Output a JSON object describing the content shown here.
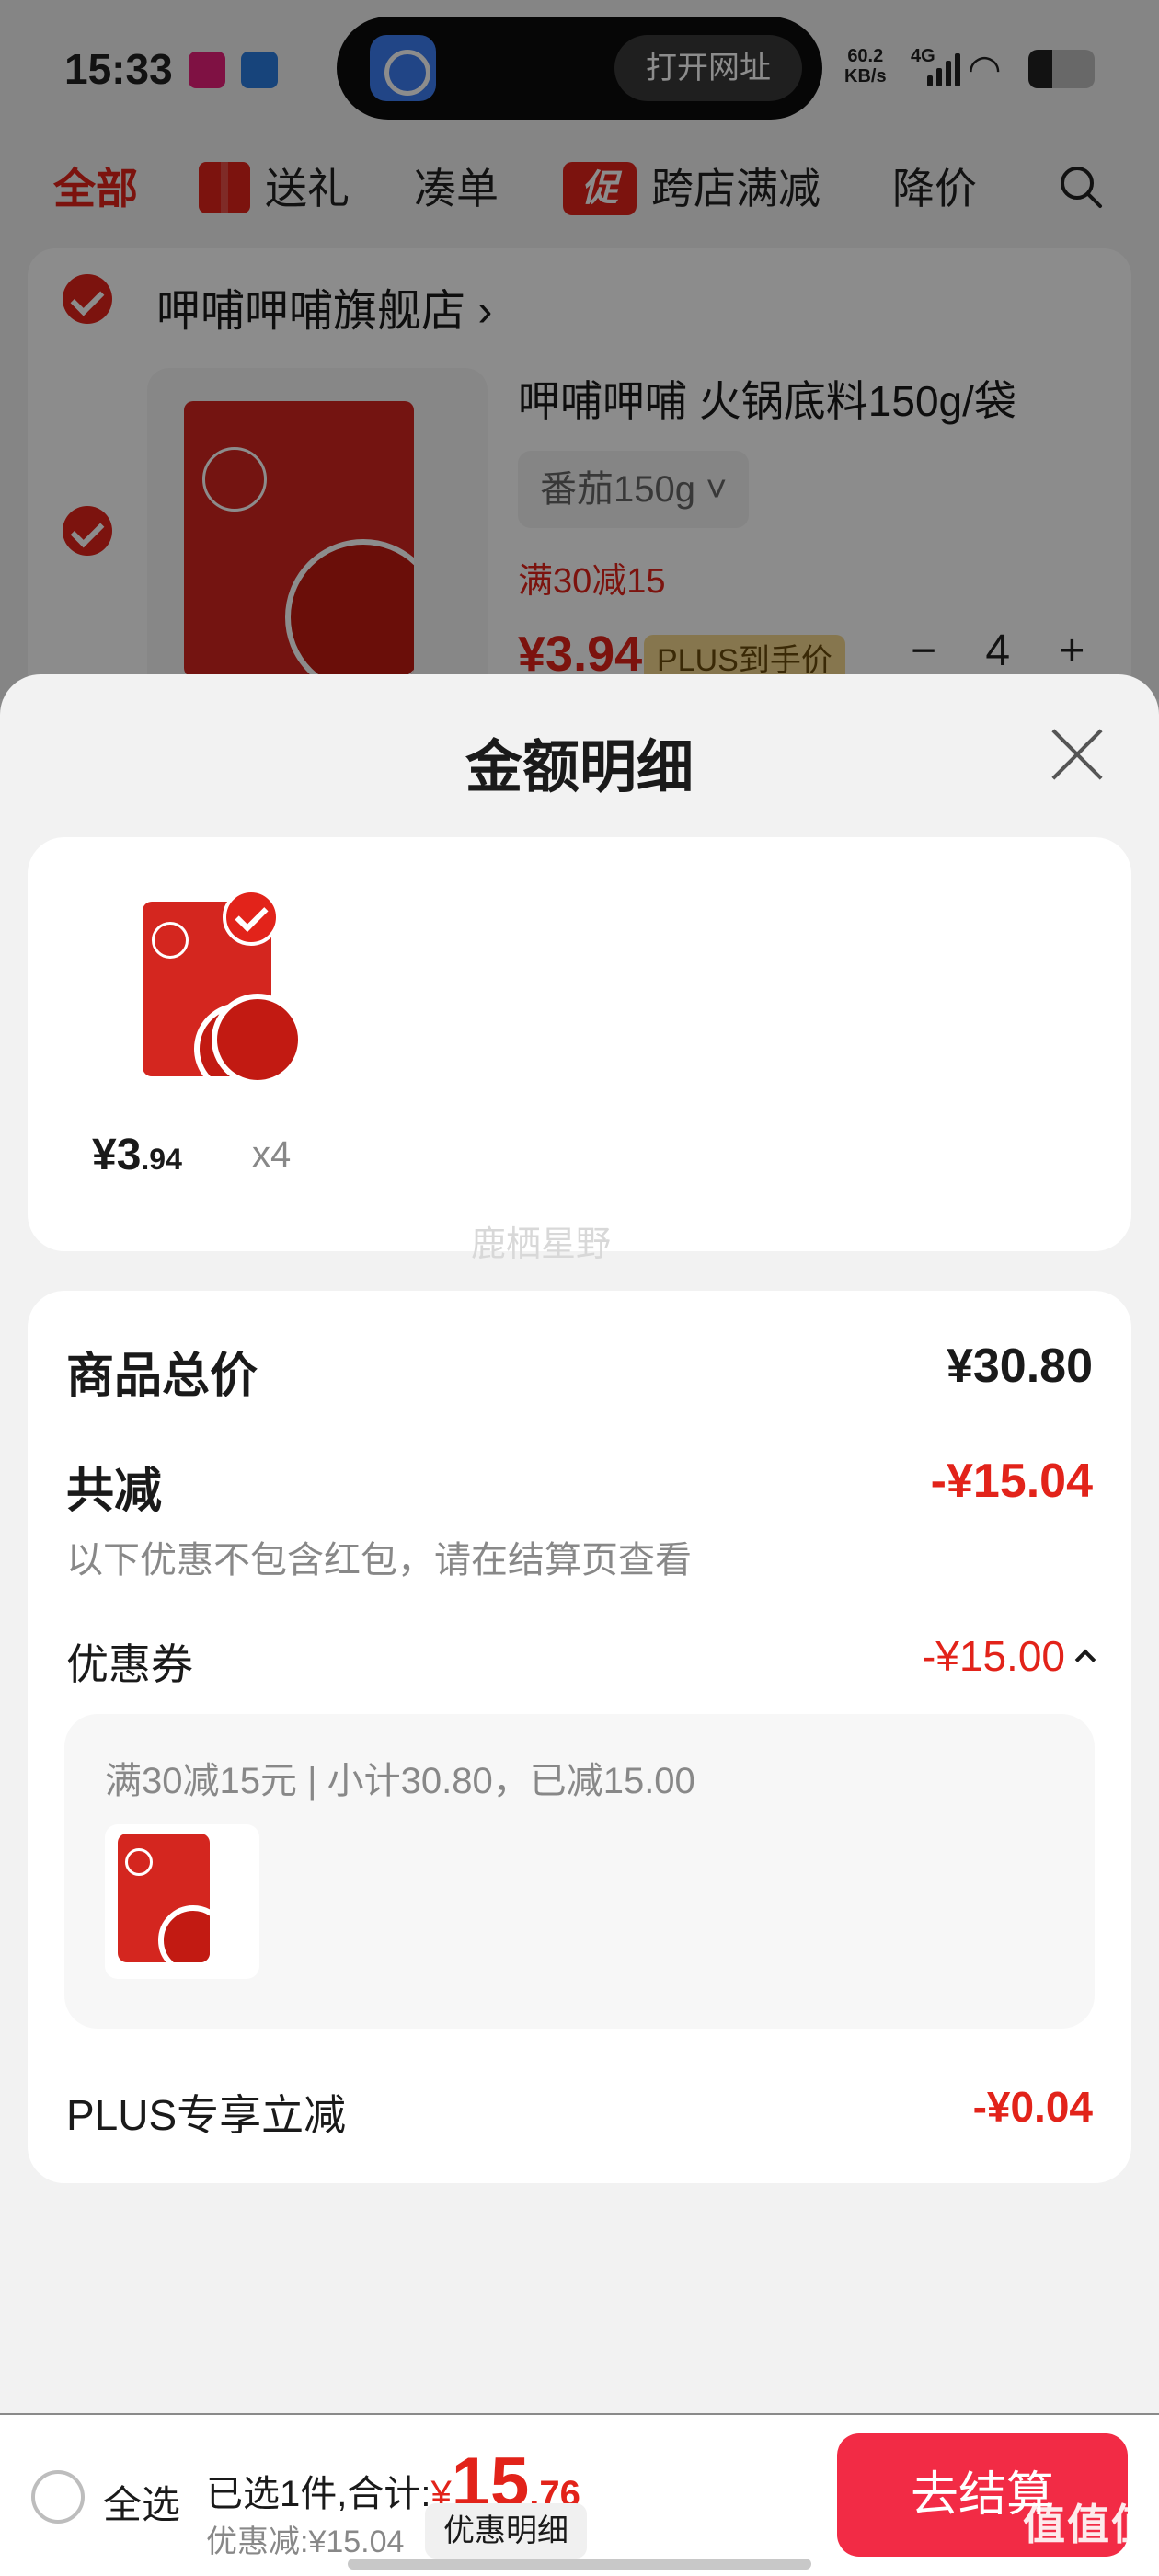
{
  "status_bar": {
    "time": "15:33",
    "island_button": "打开网址",
    "net_speed_value": "60.2",
    "net_speed_unit": "KB/s",
    "signal": "4G"
  },
  "tabs": [
    {
      "label": "全部",
      "active": true
    },
    {
      "label": "送礼",
      "icon": "gift-icon"
    },
    {
      "label": "凑单"
    },
    {
      "label": "跨店满减",
      "badge": "促"
    },
    {
      "label": "降价"
    }
  ],
  "store": {
    "name": "呷哺呷哺旗舰店",
    "product": {
      "title": "呷哺呷哺 火锅底料150g/袋",
      "variant": "番茄150g",
      "promo": "满30减15",
      "price": "¥3.94",
      "plus_badge": "PLUS到手价",
      "quantity": "4"
    }
  },
  "sheet": {
    "title": "金额明细",
    "item": {
      "price_int": "¥3",
      "price_dec": ".94",
      "qty": "x4"
    },
    "watermark": "鹿栖星野",
    "total_label": "商品总价",
    "total_value": "¥30.80",
    "reduce_label": "共减",
    "reduce_value": "-¥15.04",
    "note": "以下优惠不包含红包，请在结算页查看",
    "coupon_label": "优惠券",
    "coupon_value": "-¥15.00",
    "coupon_detail": "满30减15元 | 小计30.80，已减15.00",
    "plus_label": "PLUS专享立减",
    "plus_value": "-¥0.04"
  },
  "bottom_bar": {
    "select_all": "全选",
    "summary_prefix": "已选1件,合计:",
    "total_currency": "¥",
    "total_int": "15",
    "total_dec": ".76",
    "discount": "优惠减:¥15.04",
    "detail_button": "优惠明细",
    "checkout_button": "去结算",
    "corner_mark": "值值值"
  },
  "colors": {
    "accent": "#e2231a",
    "checkout": "#f22b45",
    "plus_gold": "#f5d88f"
  }
}
